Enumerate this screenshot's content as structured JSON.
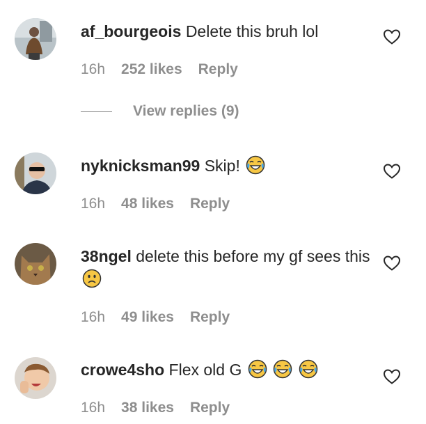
{
  "comments": [
    {
      "username": "af_bourgeois",
      "text": "Delete this bruh lol",
      "emojis": [],
      "time": "16h",
      "likes": "252 likes",
      "reply": "Reply",
      "view_replies": "View replies (9)"
    },
    {
      "username": "nyknicksman99",
      "text": "Skip!",
      "emojis": [
        "face-with-tears-of-joy"
      ],
      "time": "16h",
      "likes": "48 likes",
      "reply": "Reply"
    },
    {
      "username": "38ngel",
      "text": "delete this before my gf sees this",
      "emojis": [
        "slightly-frowning-face"
      ],
      "time": "16h",
      "likes": "49 likes",
      "reply": "Reply"
    },
    {
      "username": "crowe4sho",
      "text": "Flex old G",
      "emojis": [
        "face-with-tears-of-joy",
        "face-with-tears-of-joy",
        "face-with-tears-of-joy"
      ],
      "time": "16h",
      "likes": "38 likes",
      "reply": "Reply"
    }
  ],
  "icons": {
    "like": "heart-icon"
  },
  "colors": {
    "text": "#262626",
    "muted": "#8e8e8e",
    "emoji": "#f7c744"
  }
}
